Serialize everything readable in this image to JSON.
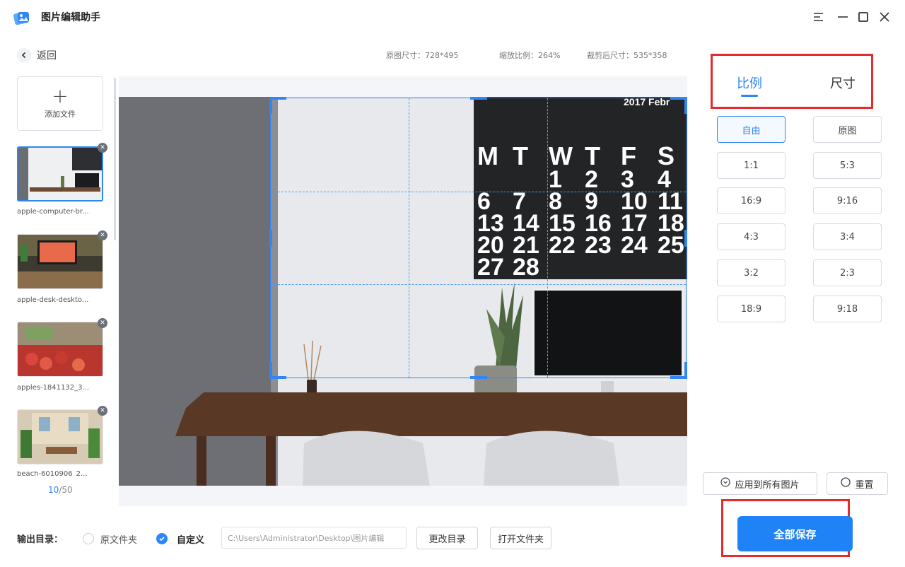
{
  "app": {
    "title": "图片编辑助手"
  },
  "window_controls": {
    "menu_icon": "menu-icon",
    "minimize_icon": "minimize-icon",
    "maximize_icon": "maximize-icon",
    "close_icon": "close-icon"
  },
  "header": {
    "back_label": "返回",
    "original_size": "原图尺寸：728*495",
    "zoom_ratio": "缩放比例：264%",
    "cropped_size": "裁剪后尺寸：535*358"
  },
  "sidebar": {
    "add_file_label": "添加文件",
    "files": [
      {
        "name": "apple-computer-br...",
        "selected": true
      },
      {
        "name": "apple-desk-deskto...",
        "selected": false
      },
      {
        "name": "apples-1841132_3...",
        "selected": false
      },
      {
        "name": "beach-6010906_2...",
        "selected": false
      }
    ],
    "pager_current": "10",
    "pager_total": "/50"
  },
  "calendar": {
    "header": "2017   Febr",
    "days": [
      "M",
      "T",
      "W",
      "T",
      "F",
      "S"
    ],
    "rows": [
      [
        "",
        "",
        "1",
        "2",
        "3",
        "4"
      ],
      [
        "6",
        "7",
        "8",
        "9",
        "10",
        "11"
      ],
      [
        "13",
        "14",
        "15",
        "16",
        "17",
        "18"
      ],
      [
        "20",
        "21",
        "22",
        "23",
        "24",
        "25"
      ],
      [
        "27",
        "28",
        "",
        "",
        "",
        ""
      ]
    ]
  },
  "right_panel": {
    "tabs": [
      {
        "label": "比例",
        "active": true
      },
      {
        "label": "尺寸",
        "active": false
      }
    ],
    "ratios": [
      "自由",
      "原图",
      "1:1",
      "5:3",
      "16:9",
      "9:16",
      "4:3",
      "3:4",
      "3:2",
      "2:3",
      "18:9",
      "9:18"
    ],
    "active_ratio": "自由",
    "apply_all_label": "应用到所有图片",
    "reset_label": "重置",
    "save_all_label": "全部保存"
  },
  "output": {
    "label": "输出目录：",
    "option_original": "原文件夹",
    "option_custom": "自定义",
    "selected": "自定义",
    "path": "C:\\Users\\Administrator\\Desktop\\图片编辑",
    "change_dir_label": "更改目录",
    "open_folder_label": "打开文件夹"
  },
  "colors": {
    "accent": "#2f86f6",
    "highlight_box": "#e52b2b"
  }
}
